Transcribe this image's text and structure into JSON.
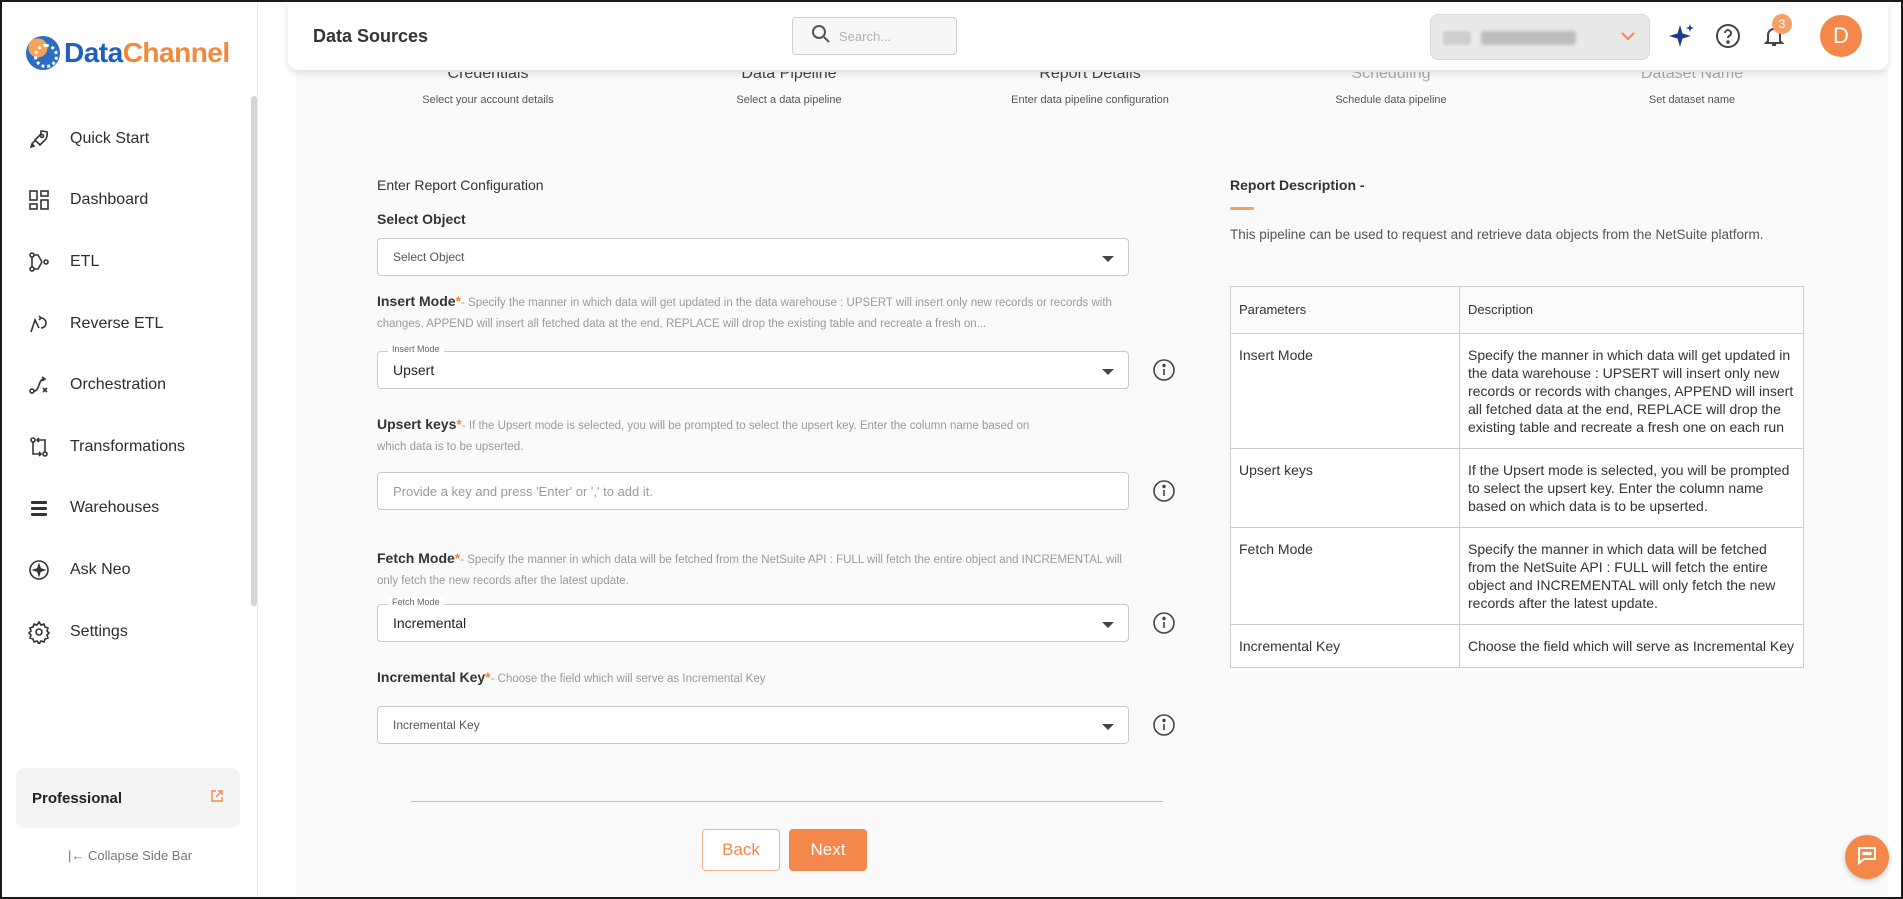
{
  "brand": {
    "name_part1": "Data",
    "name_part2": "Channel"
  },
  "sidebar": {
    "items": [
      {
        "label": "Quick Start",
        "icon": "rocket-icon"
      },
      {
        "label": "Dashboard",
        "icon": "dashboard-icon"
      },
      {
        "label": "ETL",
        "icon": "etl-icon"
      },
      {
        "label": "Reverse ETL",
        "icon": "reverse-etl-icon"
      },
      {
        "label": "Orchestration",
        "icon": "orchestration-icon"
      },
      {
        "label": "Transformations",
        "icon": "transformations-icon"
      },
      {
        "label": "Warehouses",
        "icon": "warehouses-icon"
      },
      {
        "label": "Ask Neo",
        "icon": "ask-neo-icon"
      },
      {
        "label": "Settings",
        "icon": "gear-icon"
      }
    ],
    "plan": "Professional",
    "collapse_label": "Collapse Side Bar"
  },
  "header": {
    "title": "Data Sources",
    "search_placeholder": "Search...",
    "notifications_count": "3",
    "avatar_initial": "D"
  },
  "stepper": [
    {
      "title": "Credentials",
      "sub": "Select your account details"
    },
    {
      "title": "Data Pipeline",
      "sub": "Select a data pipeline"
    },
    {
      "title": "Report Details",
      "sub": "Enter data pipeline configuration"
    },
    {
      "title": "Scheduling",
      "sub": "Schedule data pipeline"
    },
    {
      "title": "Dataset Name",
      "sub": "Set dataset name"
    }
  ],
  "form": {
    "section_title": "Enter Report Configuration",
    "select_object": {
      "label": "Select Object",
      "placeholder": "Select Object"
    },
    "insert_mode": {
      "label": "Insert Mode",
      "required_mark": "*",
      "help": "- Specify the manner in which data will get updated in the data warehouse : UPSERT will insert only new records or records with changes, APPEND will insert all fetched data at the end, REPLACE will drop the existing table and recreate a fresh on...",
      "float_label": "Insert Mode",
      "value": "Upsert"
    },
    "upsert_keys": {
      "label": "Upsert keys",
      "required_mark": "*",
      "help": "- If the Upsert mode is selected, you will be prompted to select the upsert key. Enter the column name based on which data is to be upserted.",
      "placeholder": "Provide a key and press 'Enter' or ',' to add it."
    },
    "fetch_mode": {
      "label": "Fetch Mode",
      "required_mark": "*",
      "help": "- Specify the manner in which data will be fetched from the NetSuite API : FULL will fetch the entire object and INCREMENTAL will only fetch the new records after the latest update.",
      "float_label": "Fetch Mode",
      "value": "Incremental"
    },
    "incremental_key": {
      "label": "Incremental Key",
      "required_mark": "*",
      "help": "- Choose the field which will serve as Incremental Key",
      "placeholder": "Incremental Key"
    },
    "back_label": "Back",
    "next_label": "Next"
  },
  "report": {
    "title": "Report Description -",
    "description": "This pipeline can be used to request and retrieve data objects from the NetSuite platform.",
    "table_headers": [
      "Parameters",
      "Description"
    ],
    "rows": [
      {
        "param": "Insert Mode",
        "desc": "Specify the manner in which data will get updated in the data warehouse : UPSERT will insert only new records or records with changes, APPEND will insert all fetched data at the end, REPLACE will drop the existing table and recreate a fresh one on each run"
      },
      {
        "param": "Upsert keys",
        "desc": "If the Upsert mode is selected, you will be prompted to select the upsert key. Enter the column name based on which data is to be upserted."
      },
      {
        "param": "Fetch Mode",
        "desc": "Specify the manner in which data will be fetched from the NetSuite API : FULL will fetch the entire object and INCREMENTAL will only fetch the new records after the latest update."
      },
      {
        "param": "Incremental Key",
        "desc": "Choose the field which will serve as Incremental Key"
      }
    ]
  },
  "colors": {
    "accent": "#f4884a",
    "brand_blue": "#1f5fbf"
  }
}
